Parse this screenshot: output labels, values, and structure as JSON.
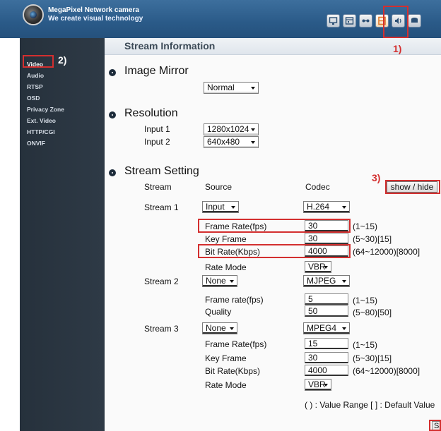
{
  "header": {
    "brand_line1": "MegaPixel Network camera",
    "brand_line2": "We create visual technology",
    "toolbar": [
      {
        "icon": "monitor-icon"
      },
      {
        "icon": "calendar-icon"
      },
      {
        "icon": "network-icon"
      },
      {
        "icon": "stream-icon",
        "active": true
      },
      {
        "icon": "audio-icon"
      },
      {
        "icon": "storage-icon"
      }
    ]
  },
  "sidebar": {
    "items": [
      {
        "label": "Video",
        "active": true
      },
      {
        "label": "Audio"
      },
      {
        "label": "RTSP"
      },
      {
        "label": "OSD"
      },
      {
        "label": "Privacy Zone"
      },
      {
        "label": "Ext. Video"
      },
      {
        "label": "HTTP/CGI"
      },
      {
        "label": "ONVIF"
      }
    ]
  },
  "page": {
    "title": "Stream Information"
  },
  "image_mirror": {
    "title": "Image Mirror",
    "value": "Normal"
  },
  "resolution": {
    "title": "Resolution",
    "input1": {
      "label": "Input 1",
      "value": "1280x1024"
    },
    "input2": {
      "label": "Input 2",
      "value": "640x480"
    }
  },
  "stream_setting": {
    "title": "Stream Setting",
    "headers": {
      "stream": "Stream",
      "source": "Source",
      "codec": "Codec"
    },
    "show_hide_label": "show / hide",
    "stream1": {
      "label": "Stream 1",
      "source": "Input",
      "codec": "H.264",
      "frame_rate": {
        "label": "Frame Rate(fps)",
        "value": "30",
        "range": "(1~15)"
      },
      "key_frame": {
        "label": "Key Frame",
        "value": "30",
        "range": "(5~30)[15]"
      },
      "bit_rate": {
        "label": "Bit Rate(Kbps)",
        "value": "4000",
        "range": "(64~12000)[8000]"
      },
      "rate_mode": {
        "label": "Rate Mode",
        "value": "VBR"
      }
    },
    "stream2": {
      "label": "Stream 2",
      "source": "None",
      "codec": "MJPEG",
      "frame_rate": {
        "label": "Frame rate(fps)",
        "value": "5",
        "range": "(1~15)"
      },
      "quality": {
        "label": "Quality",
        "value": "50",
        "range": "(5~80)[50]"
      }
    },
    "stream3": {
      "label": "Stream 3",
      "source": "None",
      "codec": "MPEG4",
      "frame_rate": {
        "label": "Frame Rate(fps)",
        "value": "15",
        "range": "(1~15)"
      },
      "key_frame": {
        "label": "Key Frame",
        "value": "30",
        "range": "(5~30)[15]"
      },
      "bit_rate": {
        "label": "Bit Rate(Kbps)",
        "value": "4000",
        "range": "(64~12000)[8000]"
      },
      "rate_mode": {
        "label": "Rate Mode",
        "value": "VBR"
      }
    },
    "legend": "( ) : Value Range  [ ] : Default Value"
  },
  "save_label": "Sa",
  "annotations": {
    "a1": "1)",
    "a2": "2)",
    "a3": "3)"
  },
  "colors": {
    "annotation_red": "#d32f2f",
    "header_blue": "#2a5a88",
    "sidebar_dark": "#2a3540"
  }
}
